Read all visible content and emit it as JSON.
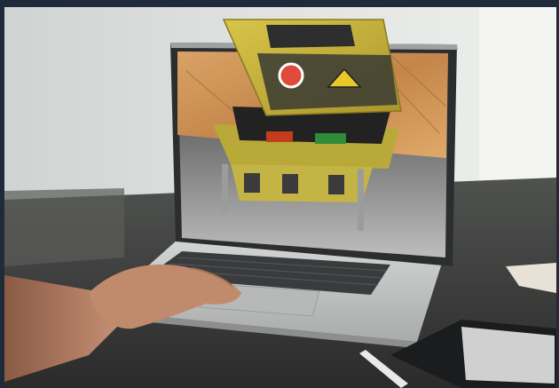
{
  "image": {
    "subject": "laptop-floor-box-render",
    "colors": {
      "border": "#1f2a3a",
      "wall": "#d9dcda",
      "desk": "#3c3d3c",
      "laptop_silver": "#c3c5c4",
      "lid_yellow": "#c9b43c",
      "wood": "#c98f52"
    }
  }
}
